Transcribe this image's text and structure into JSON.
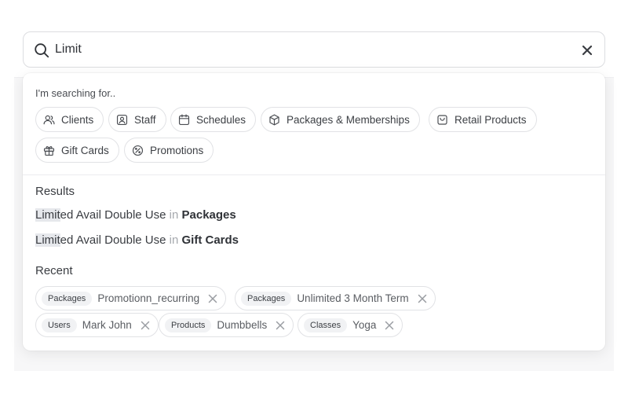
{
  "search": {
    "value": "Limit",
    "placeholder": ""
  },
  "dropdown": {
    "searching_label": "I'm searching for..",
    "filters": [
      {
        "label": "Clients",
        "icon": "users-icon"
      },
      {
        "label": "Staff",
        "icon": "staff-badge-icon"
      },
      {
        "label": "Schedules",
        "icon": "calendar-icon"
      },
      {
        "label": "Packages & Memberships",
        "icon": "package-box-icon"
      },
      {
        "label": "Retail Products",
        "icon": "shopping-bag-icon"
      },
      {
        "label": "Gift Cards",
        "icon": "gift-icon"
      },
      {
        "label": "Promotions",
        "icon": "discount-badge-icon"
      }
    ],
    "results_title": "Results",
    "results": [
      {
        "match": "Limit",
        "rest": "ed Avail Double Use",
        "in": "in",
        "category": "Packages"
      },
      {
        "match": "Limit",
        "rest": "ed Avail Double Use",
        "in": "in",
        "category": "Gift Cards"
      }
    ],
    "recent_title": "Recent",
    "recent": [
      {
        "tag": "Packages",
        "text": "Promotionn_recurring"
      },
      {
        "tag": "Packages",
        "text": "Unlimited 3 Month Term"
      },
      {
        "tag": "Users",
        "text": "Mark John"
      },
      {
        "tag": "Products",
        "text": "Dumbbells"
      },
      {
        "tag": "Classes",
        "text": "Yoga"
      }
    ]
  }
}
